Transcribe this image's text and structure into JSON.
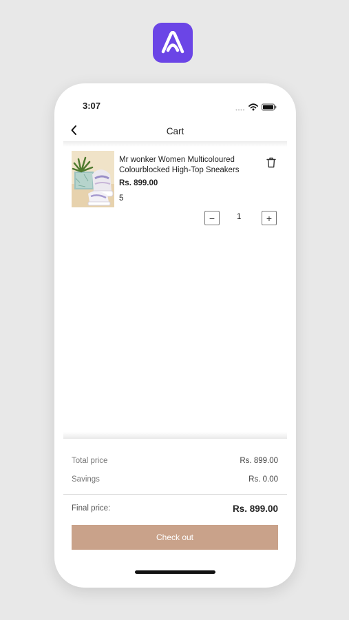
{
  "status_bar": {
    "time": "3:07"
  },
  "nav": {
    "title": "Cart"
  },
  "cart_item": {
    "name": "Mr wonker Women Multicoloured Colourblocked High-Top Sneakers",
    "price": "Rs. 899.00",
    "size": "5",
    "quantity": "1",
    "minus_label": "−",
    "plus_label": "+"
  },
  "summary": {
    "total_label": "Total price",
    "total_value": "Rs. 899.00",
    "savings_label": "Savings",
    "savings_value": "Rs. 0.00",
    "final_label": "Final price:",
    "final_value": "Rs. 899.00"
  },
  "checkout": {
    "label": "Check out"
  },
  "colors": {
    "brand": "#6b45e6",
    "checkout": "#c9a28a"
  },
  "icons": [
    "app-logo-icon",
    "wifi-icon",
    "battery-icon",
    "cellular-icon",
    "back-icon",
    "trash-icon"
  ]
}
